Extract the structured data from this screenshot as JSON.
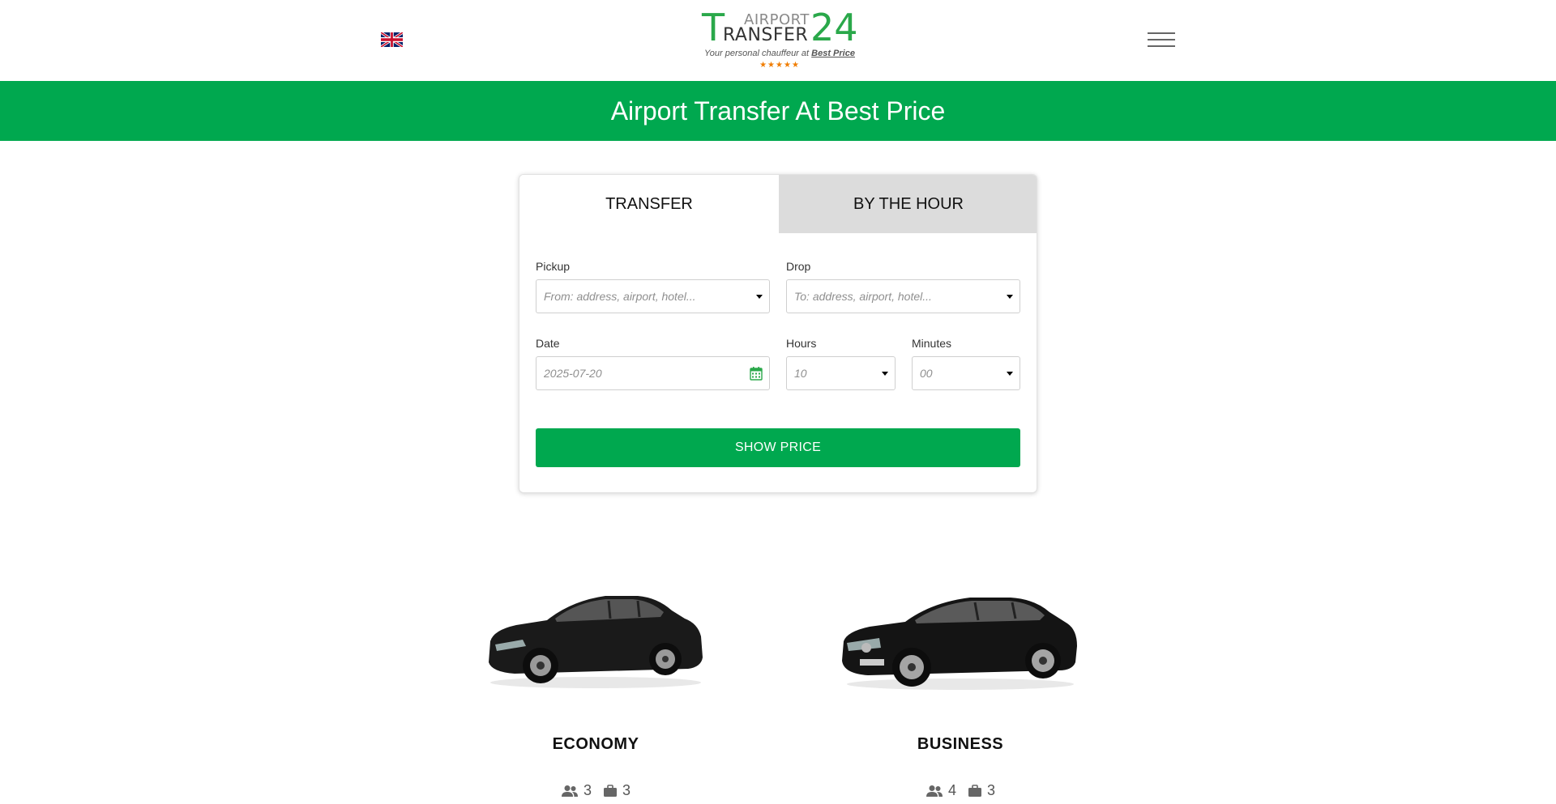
{
  "header": {
    "language_flag": "uk-flag-icon",
    "logo": {
      "t_letter": "T",
      "airport": "AIRPORT",
      "transfer": "RANSFER",
      "number": "24",
      "tagline_prefix": "Your personal chauffeur at ",
      "tagline_emphasis": "Best Price",
      "stars": "★★★★★"
    },
    "menu_icon": "hamburger-menu-icon"
  },
  "banner": {
    "title": "Airport Transfer At Best Price",
    "background_color": "#00a84f"
  },
  "booking": {
    "tabs": [
      {
        "label": "TRANSFER",
        "active": true
      },
      {
        "label": "BY THE HOUR",
        "active": false
      }
    ],
    "pickup": {
      "label": "Pickup",
      "placeholder": "From: address, airport, hotel..."
    },
    "drop": {
      "label": "Drop",
      "placeholder": "To: address, airport, hotel..."
    },
    "date": {
      "label": "Date",
      "value": "2025-07-20",
      "icon": "calendar-icon"
    },
    "hours": {
      "label": "Hours",
      "value": "10"
    },
    "minutes": {
      "label": "Minutes",
      "value": "00"
    },
    "submit_label": "SHOW PRICE"
  },
  "vehicles": [
    {
      "name": "ECONOMY",
      "passengers": "3",
      "luggage": "3",
      "image": "economy-car-image"
    },
    {
      "name": "BUSINESS",
      "passengers": "4",
      "luggage": "3",
      "image": "business-car-image"
    }
  ],
  "colors": {
    "brand_green": "#00a84f",
    "logo_green": "#2aa84a",
    "star_orange": "#f07d00"
  }
}
